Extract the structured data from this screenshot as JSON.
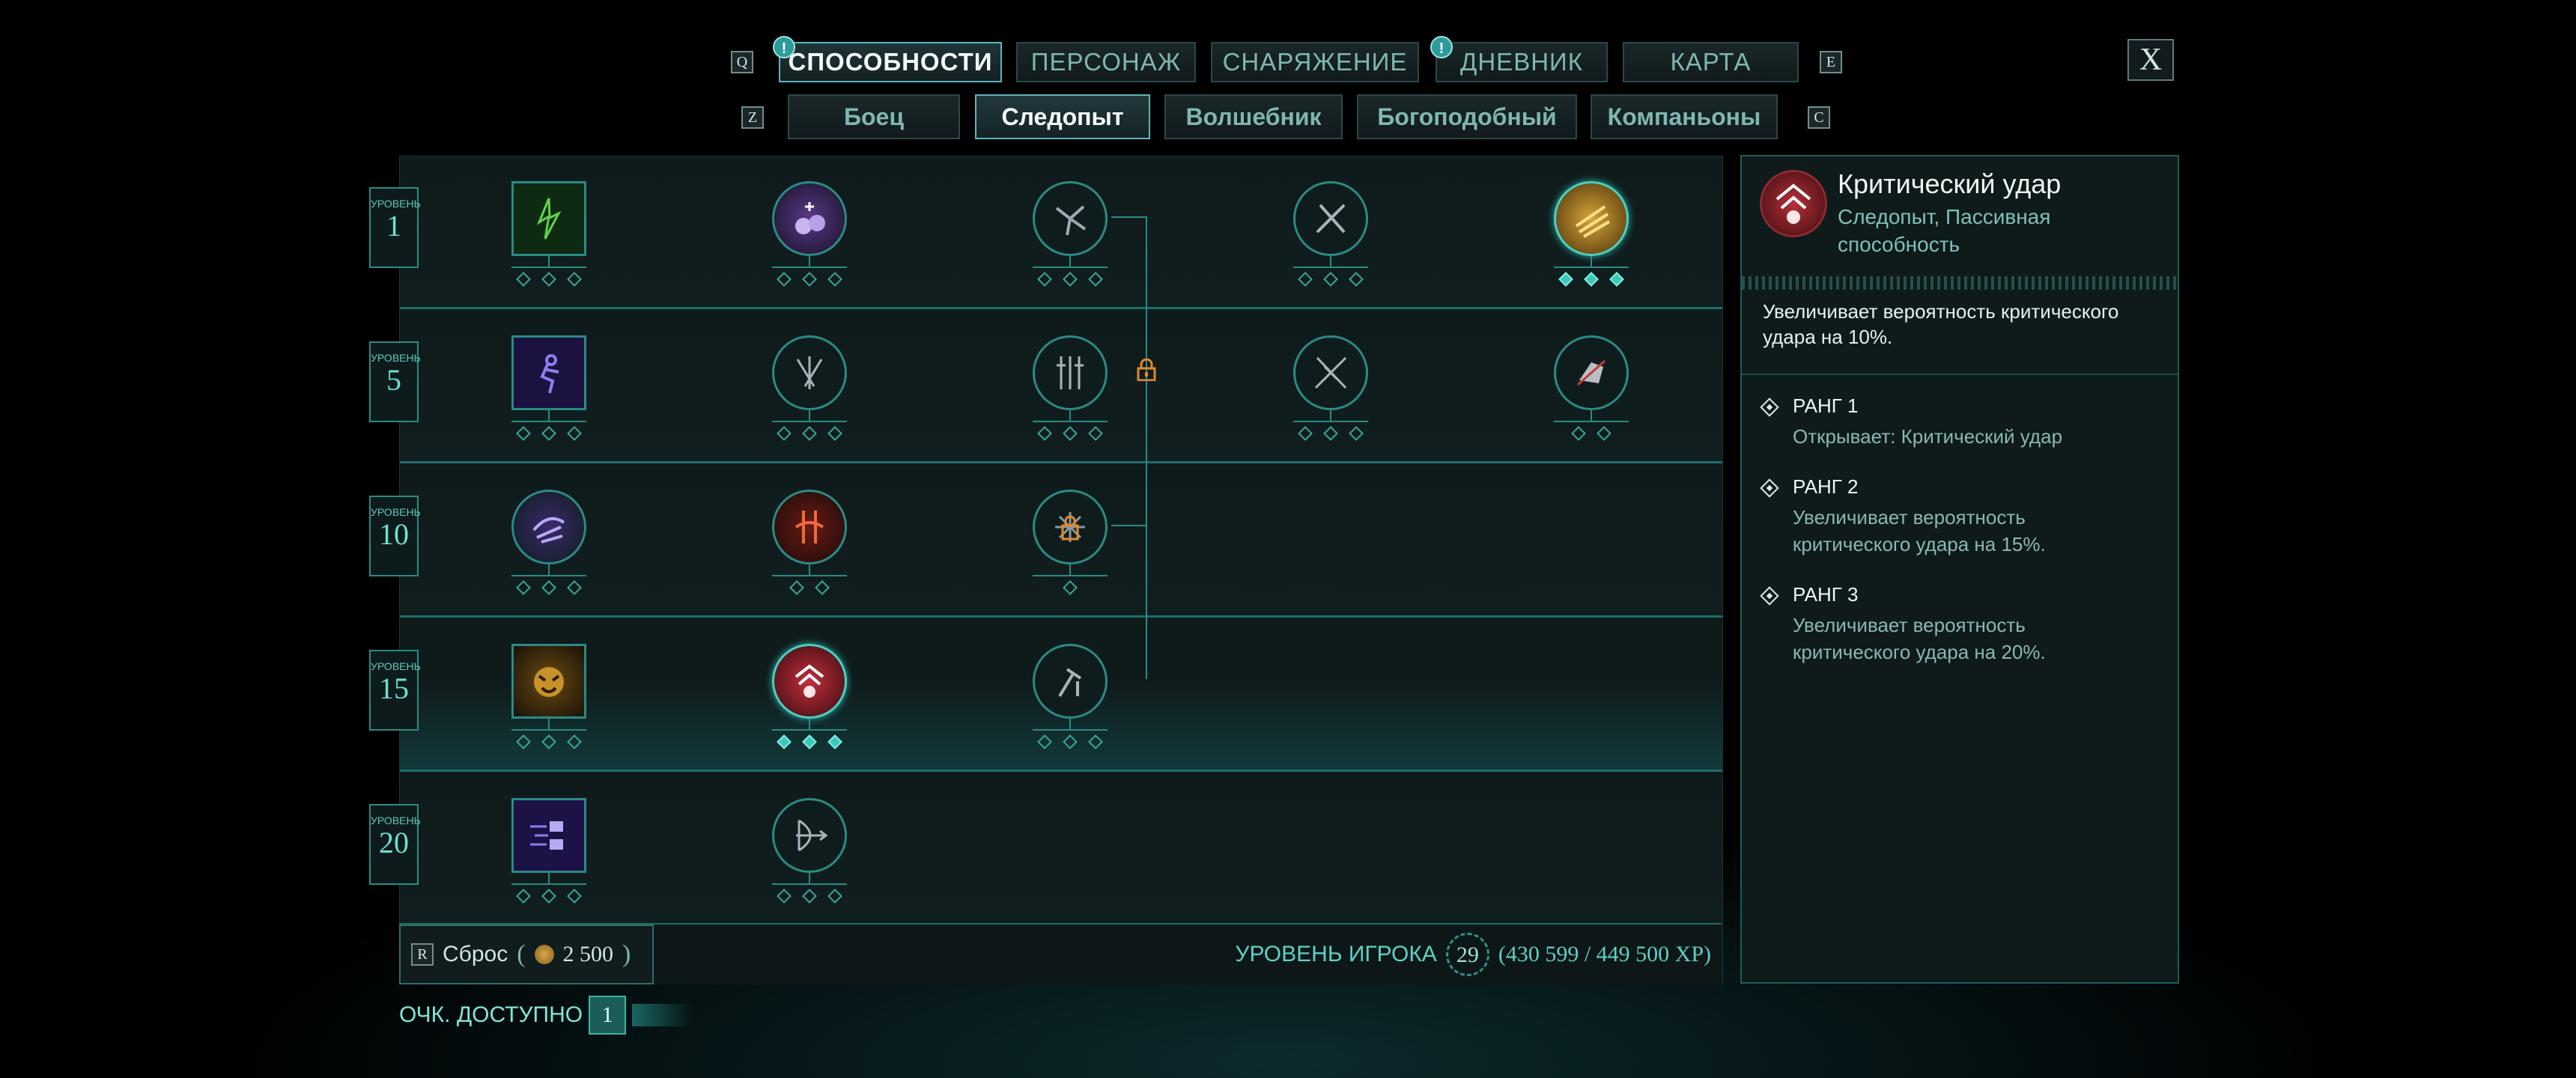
{
  "tabs": {
    "left_key": "Q",
    "right_key": "E",
    "items": [
      {
        "label": "СПОСОБНОСТИ",
        "active": true,
        "alert": "!"
      },
      {
        "label": "ПЕРСОНАЖ"
      },
      {
        "label": "СНАРЯЖЕНИЕ"
      },
      {
        "label": "ДНЕВНИК",
        "alert": "!"
      },
      {
        "label": "КАРТА"
      }
    ]
  },
  "subtabs": {
    "left_key": "Z",
    "right_key": "C",
    "items": [
      {
        "label": "Боец"
      },
      {
        "label": "Следопыт",
        "active": true
      },
      {
        "label": "Волшебник"
      },
      {
        "label": "Богоподобный"
      },
      {
        "label": "Компаньоны"
      }
    ]
  },
  "close_label": "X",
  "tree": {
    "level_caption": "УРОВЕНЬ",
    "levels": [
      "1",
      "5",
      "10",
      "15",
      "20"
    ]
  },
  "footer": {
    "reset_key": "R",
    "reset_label": "Сброс",
    "reset_cost": "2 500",
    "player_level_label": "УРОВЕНЬ ИГРОКА",
    "player_level": "29",
    "xp": "(430 599 / 449 500 XP)"
  },
  "points": {
    "label": "ОЧК. ДОСТУПНО",
    "value": "1"
  },
  "info": {
    "title": "Критический удар",
    "subtitle": "Следопыт, Пассивная способность",
    "description": "Увеличивает вероятность критического удара на 10%.",
    "ranks": [
      {
        "heading": "РАНГ 1",
        "text": "Открывает: Критический удар"
      },
      {
        "heading": "РАНГ 2",
        "text": "Увеличивает вероятность критического удара на 15%."
      },
      {
        "heading": "РАНГ 3",
        "text": "Увеличивает вероятность критического удара на 20%."
      }
    ]
  },
  "colors": {
    "accent": "#2b8a86",
    "active_pip": "#3ec7b8",
    "selected_skill": "#b8303a"
  }
}
